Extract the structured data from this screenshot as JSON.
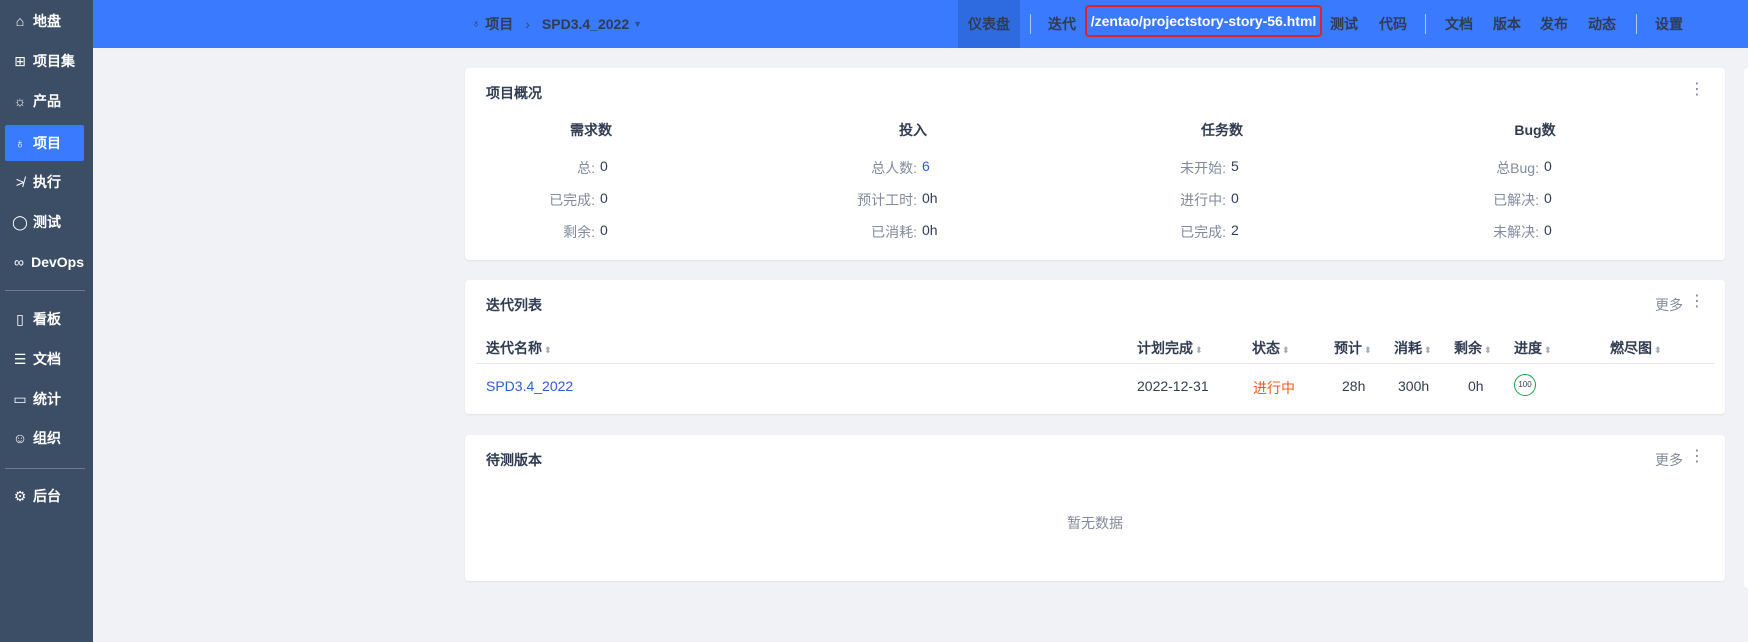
{
  "sidebar": {
    "items": [
      {
        "label": "地盘",
        "icon": "home-icon"
      },
      {
        "label": "项目集",
        "icon": "grid-icon"
      },
      {
        "label": "产品",
        "icon": "lightbulb-icon"
      },
      {
        "label": "项目",
        "icon": "rocket-icon",
        "active": true
      },
      {
        "label": "执行",
        "icon": "run-icon"
      },
      {
        "label": "测试",
        "icon": "magnifier-icon"
      },
      {
        "label": "DevOps",
        "icon": "infinity-icon"
      },
      {
        "label": "看板",
        "icon": "kanban-icon"
      },
      {
        "label": "文档",
        "icon": "doc-icon"
      },
      {
        "label": "统计",
        "icon": "monitor-icon"
      },
      {
        "label": "组织",
        "icon": "users-icon"
      },
      {
        "label": "后台",
        "icon": "gear-icon"
      }
    ]
  },
  "header": {
    "breadcrumb": {
      "root": "项目",
      "current": "SPD3.4_2022"
    },
    "nav": {
      "dashboard": "仪表盘",
      "iteration": "迭代",
      "url_overlay": "/zentao/projectstory-story-56.html",
      "test": "测试",
      "code": "代码",
      "doc": "文档",
      "build": "版本",
      "release": "发布",
      "dynamic": "动态",
      "settings": "设置"
    }
  },
  "overview": {
    "title": "项目概况",
    "columns": [
      {
        "heading": "需求数",
        "rows": [
          {
            "label": "总:",
            "value": "0"
          },
          {
            "label": "已完成:",
            "value": "0"
          },
          {
            "label": "剩余:",
            "value": "0"
          }
        ]
      },
      {
        "heading": "投入",
        "rows": [
          {
            "label": "总人数:",
            "value": "6"
          },
          {
            "label": "预计工时:",
            "value": "0h"
          },
          {
            "label": "已消耗:",
            "value": "0h"
          }
        ]
      },
      {
        "heading": "任务数",
        "rows": [
          {
            "label": "未开始:",
            "value": "5"
          },
          {
            "label": "进行中:",
            "value": "0"
          },
          {
            "label": "已完成:",
            "value": "2"
          }
        ]
      },
      {
        "heading": "Bug数",
        "rows": [
          {
            "label": "总Bug:",
            "value": "0"
          },
          {
            "label": "已解决:",
            "value": "0"
          },
          {
            "label": "未解决:",
            "value": "0"
          }
        ]
      }
    ]
  },
  "iterations": {
    "title": "迭代列表",
    "more": "更多",
    "headers": [
      "迭代名称",
      "计划完成",
      "状态",
      "预计",
      "消耗",
      "剩余",
      "进度",
      "燃尽图"
    ],
    "rows": [
      {
        "name": "SPD3.4_2022",
        "end": "2022-12-31",
        "status": "进行中",
        "estimate": "28h",
        "consumed": "300h",
        "left": "0h",
        "progress": "100"
      }
    ]
  },
  "builds": {
    "title": "待测版本",
    "more": "更多",
    "empty": "暂无数据"
  },
  "colors": {
    "brand": "#3a7afe",
    "sidebar": "#3c4e66",
    "status_doing": "#fc5a1f",
    "link": "#2e5bd9"
  }
}
